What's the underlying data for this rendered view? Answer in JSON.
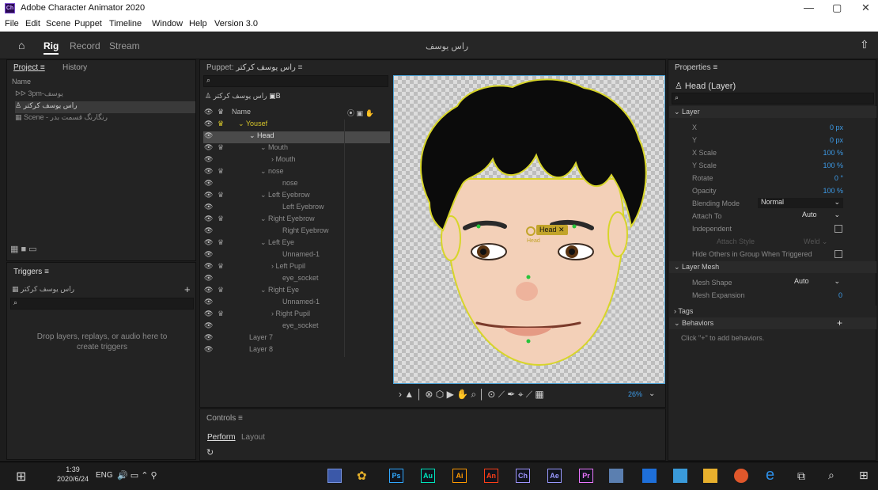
{
  "window": {
    "title": "Adobe Character Animator 2020",
    "logo": "Ch"
  },
  "menu": [
    "File",
    "Edit",
    "Scene",
    "Puppet",
    "Timeline",
    "Window",
    "Help",
    "Version 3.0"
  ],
  "modes": {
    "rig": "Rig",
    "record": "Record",
    "stream": "Stream",
    "doc_title": "راس یوسف"
  },
  "project": {
    "tab1": "Project",
    "tab2": "History",
    "name_header": "Name",
    "items": [
      "3pm-یوسف",
      "راس یوسف کرکتر",
      "Scene - رنگارنگ قسمت بدر"
    ]
  },
  "triggers": {
    "title": "Triggers",
    "puppet": "راس یوسف کرکتر",
    "drop_text": "Drop layers, replays, or audio here to create triggers",
    "add": "+"
  },
  "puppet": {
    "title": "Puppet:",
    "title_name": "راس یوسف کرکتر",
    "breadcrumb": "راس یوسف کرکتر",
    "name_header": "Name",
    "layers": [
      {
        "name": "Yousef",
        "indent": 1,
        "arrow": "v",
        "crown": true,
        "highlight": true,
        "selected": false
      },
      {
        "name": "Head",
        "indent": 2,
        "arrow": "v",
        "crown": false,
        "highlight": false,
        "selected": true
      },
      {
        "name": "Mouth",
        "indent": 3,
        "arrow": "v",
        "crown": true,
        "highlight": false,
        "selected": false
      },
      {
        "name": "Mouth",
        "indent": 4,
        "arrow": ">",
        "crown": false,
        "highlight": false,
        "selected": false
      },
      {
        "name": "nose",
        "indent": 3,
        "arrow": "v",
        "crown": true,
        "highlight": false,
        "selected": false
      },
      {
        "name": "nose",
        "indent": 5,
        "arrow": "",
        "crown": false,
        "highlight": false,
        "selected": false
      },
      {
        "name": "Left Eyebrow",
        "indent": 3,
        "arrow": "v",
        "crown": true,
        "highlight": false,
        "selected": false
      },
      {
        "name": "Left Eyebrow",
        "indent": 5,
        "arrow": "",
        "crown": false,
        "highlight": false,
        "selected": false
      },
      {
        "name": "Right Eyebrow",
        "indent": 3,
        "arrow": "v",
        "crown": true,
        "highlight": false,
        "selected": false
      },
      {
        "name": "Right Eyebrow",
        "indent": 5,
        "arrow": "",
        "crown": false,
        "highlight": false,
        "selected": false
      },
      {
        "name": "Left Eye",
        "indent": 3,
        "arrow": "v",
        "crown": true,
        "highlight": false,
        "selected": false
      },
      {
        "name": "Unnamed-1",
        "indent": 5,
        "arrow": "",
        "crown": false,
        "highlight": false,
        "selected": false
      },
      {
        "name": "Left Pupil",
        "indent": 4,
        "arrow": ">",
        "crown": true,
        "highlight": false,
        "selected": false
      },
      {
        "name": "eye_socket",
        "indent": 5,
        "arrow": "",
        "crown": false,
        "highlight": false,
        "selected": false
      },
      {
        "name": "Right Eye",
        "indent": 3,
        "arrow": "v",
        "crown": true,
        "highlight": false,
        "selected": false
      },
      {
        "name": "Unnamed-1",
        "indent": 5,
        "arrow": "",
        "crown": false,
        "highlight": false,
        "selected": false
      },
      {
        "name": "Right Pupil",
        "indent": 4,
        "arrow": ">",
        "crown": true,
        "highlight": false,
        "selected": false
      },
      {
        "name": "eye_socket",
        "indent": 5,
        "arrow": "",
        "crown": false,
        "highlight": false,
        "selected": false
      },
      {
        "name": "Layer 7",
        "indent": 2,
        "arrow": "",
        "crown": false,
        "highlight": false,
        "selected": false
      },
      {
        "name": "Layer 8",
        "indent": 2,
        "arrow": "",
        "crown": false,
        "highlight": false,
        "selected": false
      }
    ]
  },
  "canvas": {
    "tag": "Head",
    "zoom": "26%",
    "label": "Head"
  },
  "controls": {
    "title": "Controls",
    "perform": "Perform",
    "layout": "Layout"
  },
  "properties": {
    "title": "Properties",
    "selection": "Head (Layer)",
    "layer_section": "Layer",
    "rows": [
      {
        "label": "X",
        "value": "0 px"
      },
      {
        "label": "Y",
        "value": "0 px"
      },
      {
        "label": "X Scale",
        "value": "100 %"
      },
      {
        "label": "Y Scale",
        "value": "100 %"
      },
      {
        "label": "Rotate",
        "value": "0 °"
      },
      {
        "label": "Opacity",
        "value": "100 %"
      }
    ],
    "blending_label": "Blending Mode",
    "blending_value": "Normal",
    "attach_label": "Attach To",
    "attach_value": "Auto",
    "independent_label": "Independent",
    "attach_style_label": "Attach Style",
    "attach_style_value": "Weld",
    "hide_others_label": "Hide Others in Group When Triggered",
    "mesh_section": "Layer Mesh",
    "mesh_shape_label": "Mesh Shape",
    "mesh_shape_value": "Auto",
    "mesh_exp_label": "Mesh Expansion",
    "mesh_exp_value": "0",
    "tags_section": "Tags",
    "behaviors_section": "Behaviors",
    "behaviors_hint": "Click \"+\" to add behaviors."
  },
  "taskbar": {
    "time": "1:39",
    "date": "2020/6/24",
    "lang": "ENG",
    "apps": [
      {
        "t": "Ps",
        "c": "#31a8ff"
      },
      {
        "t": "Au",
        "c": "#00e4bb"
      },
      {
        "t": "Ai",
        "c": "#ff9a00"
      },
      {
        "t": "An",
        "c": "#ff3f17"
      },
      {
        "t": "Ch",
        "c": "#9f95ff"
      },
      {
        "t": "Ae",
        "c": "#9999ff"
      },
      {
        "t": "Pr",
        "c": "#ea77ff"
      }
    ]
  }
}
